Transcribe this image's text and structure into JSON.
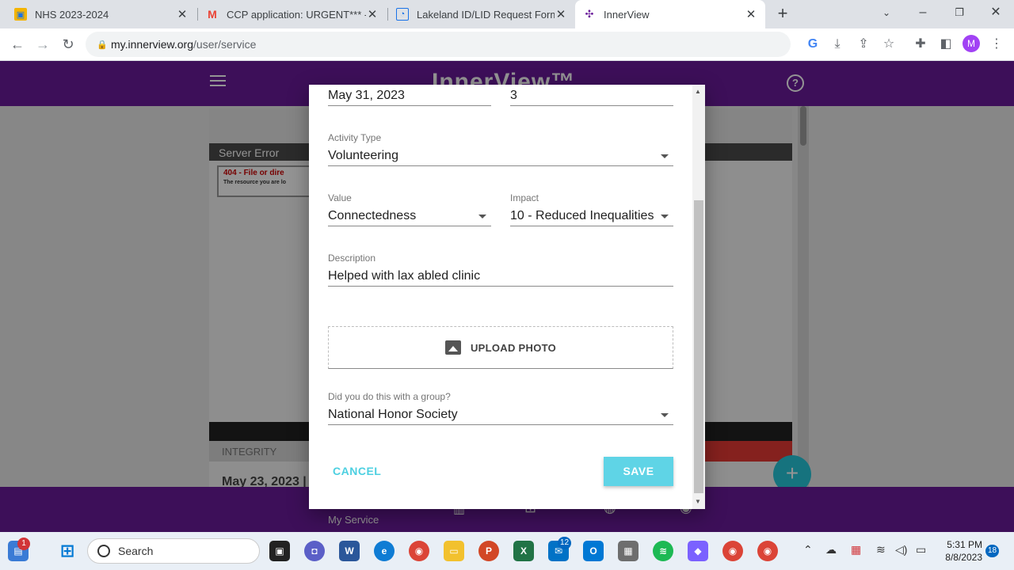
{
  "browser": {
    "tabs": [
      {
        "title": "NHS 2023-2024",
        "active": false
      },
      {
        "title": "CCP application: URGENT*** - m",
        "active": false
      },
      {
        "title": "Lakeland ID/LID Request Form - ",
        "active": false
      },
      {
        "title": "InnerView",
        "active": true
      }
    ],
    "url_host": "my.innerview.org",
    "url_path": "/user/service",
    "profile_initial": "M"
  },
  "app": {
    "brand": "InnerView™",
    "background_card": {
      "server_error": "Server Error",
      "error_title": "404 - File or dire",
      "error_detail": "The resource you are lo",
      "label": "INTEGRITY",
      "date": "May 23, 2023 |"
    },
    "bottom_nav": {
      "my_service": "My Service"
    },
    "accent_color": "#6a1b9a",
    "fab_color": "#26c6da"
  },
  "dialog": {
    "date_value": "May 31, 2023",
    "hours_value": "3",
    "activity_type": {
      "label": "Activity Type",
      "value": "Volunteering"
    },
    "value": {
      "label": "Value",
      "value": "Connectedness"
    },
    "impact": {
      "label": "Impact",
      "value": "10 - Reduced Inequalities"
    },
    "description": {
      "label": "Description",
      "value": "Helped with lax abled clinic"
    },
    "upload_label": "UPLOAD PHOTO",
    "group": {
      "label": "Did you do this with a group?",
      "value": "National Honor Society"
    },
    "cancel_label": "CANCEL",
    "save_label": "SAVE"
  },
  "taskbar": {
    "search_label": "Search",
    "widget_badge": "1",
    "mail_badge": "12",
    "notification_count": "18",
    "time": "5:31 PM",
    "date": "8/8/2023"
  }
}
